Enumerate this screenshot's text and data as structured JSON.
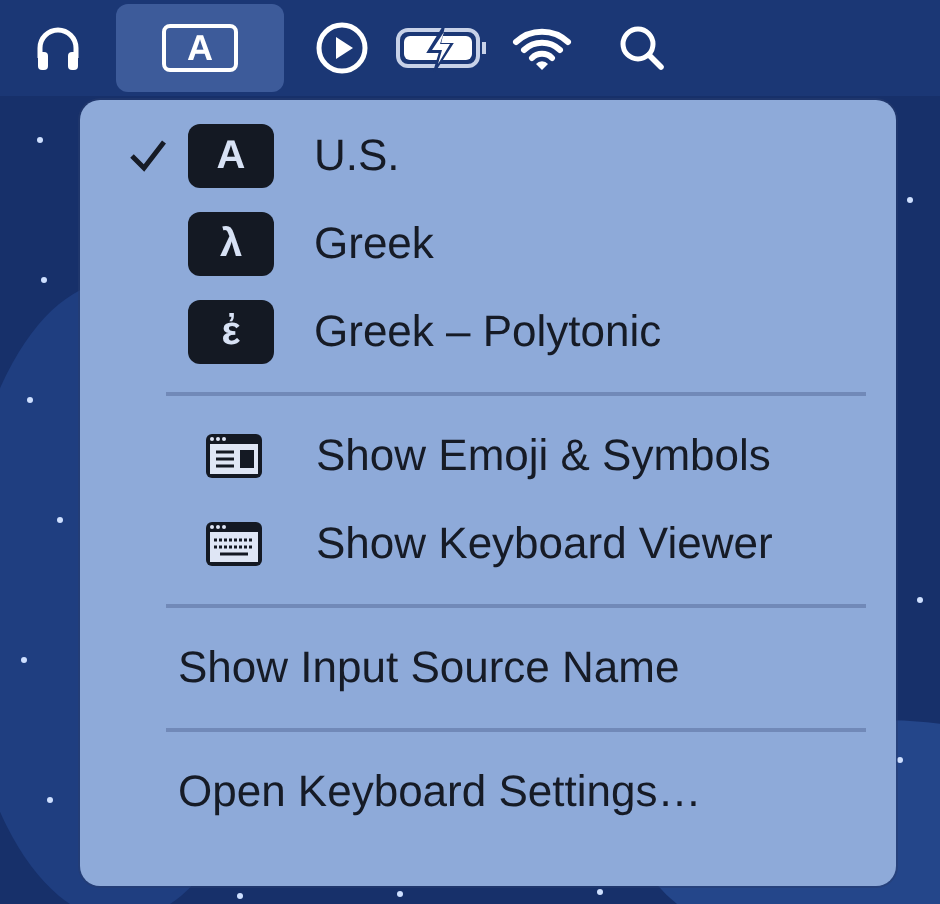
{
  "menu_bar": {
    "items": [
      {
        "kind": "headphones",
        "selected": false
      },
      {
        "kind": "input",
        "label": "A",
        "selected": true
      },
      {
        "kind": "play",
        "selected": false
      },
      {
        "kind": "battery",
        "selected": false
      },
      {
        "kind": "wifi",
        "selected": false
      },
      {
        "kind": "search",
        "selected": false
      }
    ]
  },
  "menu": {
    "sections": [
      {
        "items": [
          {
            "kind": "source",
            "badge": "A",
            "label": "U.S.",
            "checked": true
          },
          {
            "kind": "source",
            "badge": "λ",
            "label": "Greek",
            "checked": false
          },
          {
            "kind": "source",
            "badge": "ἐ",
            "label": "Greek – Polytonic",
            "checked": false
          }
        ]
      },
      {
        "items": [
          {
            "kind": "emoji",
            "label": "Show Emoji & Symbols"
          },
          {
            "kind": "keyboard",
            "label": "Show Keyboard Viewer"
          }
        ]
      },
      {
        "items": [
          {
            "kind": "plain",
            "label": "Show Input Source Name"
          }
        ]
      },
      {
        "items": [
          {
            "kind": "plain",
            "label": "Open Keyboard Settings…"
          }
        ]
      }
    ]
  }
}
